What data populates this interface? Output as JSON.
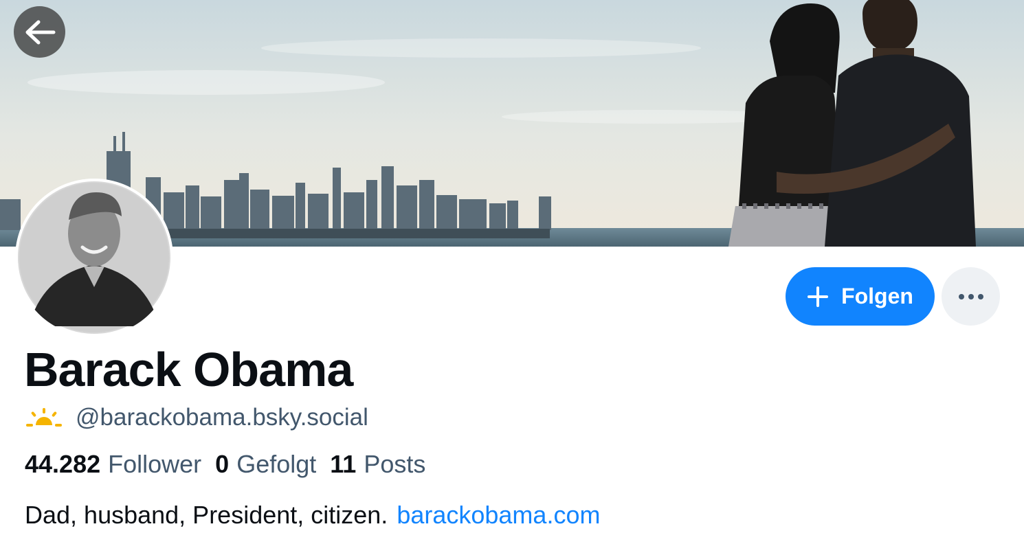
{
  "profile": {
    "display_name": "Barack Obama",
    "handle": "@barackobama.bsky.social",
    "handle_badge_icon": "sunrise-icon",
    "stats": {
      "followers_count": "44.282",
      "followers_label": "Follower",
      "following_count": "0",
      "following_label": "Gefolgt",
      "posts_count": "11",
      "posts_label": "Posts"
    },
    "bio_text": "Dad, husband, President, citizen.",
    "bio_link": "barackobama.com"
  },
  "actions": {
    "follow_label": "Folgen",
    "follow_icon": "plus-icon",
    "more_icon": "ellipsis-icon",
    "back_icon": "arrow-left-icon"
  },
  "colors": {
    "accent": "#1184fe",
    "secondary_text": "#42576c",
    "badge": "#f5b400"
  }
}
